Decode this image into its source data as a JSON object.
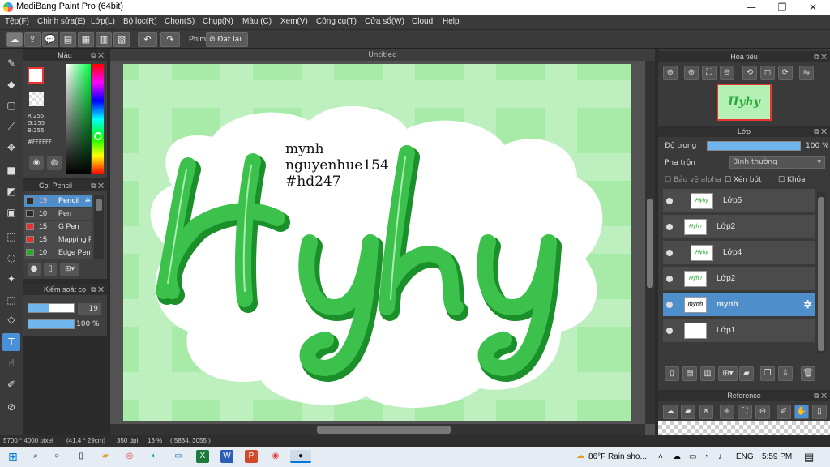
{
  "window": {
    "title": "MediBang Paint Pro (64bit)",
    "minimize": "—",
    "maximize": "❐",
    "close": "✕"
  },
  "menu": [
    "Tệp(F)",
    "Chỉnh sửa(E)",
    "Lớp(L)",
    "Bộ lọc(R)",
    "Chọn(S)",
    "Chụp(N)",
    "Màu (C)",
    "Xem(V)",
    "Công cụ(T)",
    "Cửa sổ(W)",
    "Cloud",
    "Help"
  ],
  "toolbar": {
    "key_label": "Phím",
    "reset_label": "Đặt lại"
  },
  "color_panel": {
    "title": "Màu",
    "rgb": [
      "R:255",
      "G:255",
      "B:255"
    ],
    "hex": "#FFFFFF",
    "primary_color": "#ffffff",
    "secondary_color": "#c25a1e"
  },
  "brush_panel": {
    "title": "Cọ: Pencil",
    "items": [
      {
        "size": "19",
        "name": "Pencil",
        "color": "#2b2b2b",
        "selected": true
      },
      {
        "size": "10",
        "name": "Pen",
        "color": "#2b2b2b",
        "selected": false
      },
      {
        "size": "15",
        "name": "G Pen",
        "color": "#e83030",
        "selected": false
      },
      {
        "size": "15",
        "name": "Mapping P",
        "color": "#e83030",
        "selected": false
      },
      {
        "size": "10",
        "name": "Edge Pen",
        "color": "#22b022",
        "selected": false
      }
    ]
  },
  "brush_control": {
    "title": "Kiểm soát cọ",
    "size": "19",
    "opacity": "100 %",
    "opacity_value": 1.0
  },
  "canvas": {
    "tab": "Untitled",
    "text_lines": [
      "mynh",
      "nguyenhue154",
      "#hd247"
    ],
    "lettering": "Hyhy"
  },
  "navigator": {
    "title": "Hoa tiêu",
    "thumb_text": "Hyhy"
  },
  "layers": {
    "title": "Lớp",
    "opacity_label": "Độ trong",
    "opacity": "100 %",
    "opacity_value": 1.0,
    "blend_label": "Pha trộn",
    "blend_value": "Bình thường",
    "protect_alpha": "Bảo vệ alpha",
    "clipping": "Xén bớt",
    "lock": "Khóa",
    "items": [
      {
        "name": "Lớp5",
        "thumb": "Hyhy",
        "selected": false
      },
      {
        "name": "Lớp2",
        "thumb": "Hyhy",
        "selected": false
      },
      {
        "name": "Lớp4",
        "thumb": "Hyhy",
        "selected": false
      },
      {
        "name": "Lớp2",
        "thumb": "Hyhy",
        "selected": false
      },
      {
        "name": "mynh",
        "thumb": "mynh",
        "selected": true
      },
      {
        "name": "Lớp1",
        "thumb": "",
        "selected": false
      }
    ]
  },
  "reference": {
    "title": "Reference"
  },
  "status": {
    "size": "5700 * 4000 pixel",
    "cm": "(41.4 * 29cm)",
    "dpi": "350 dpi",
    "zoom": "13 %",
    "coords": "( 5834, 3055 )"
  },
  "taskbar": {
    "weather": "86°F  Rain sho...",
    "lang": "ENG",
    "time": "5:59 PM"
  }
}
